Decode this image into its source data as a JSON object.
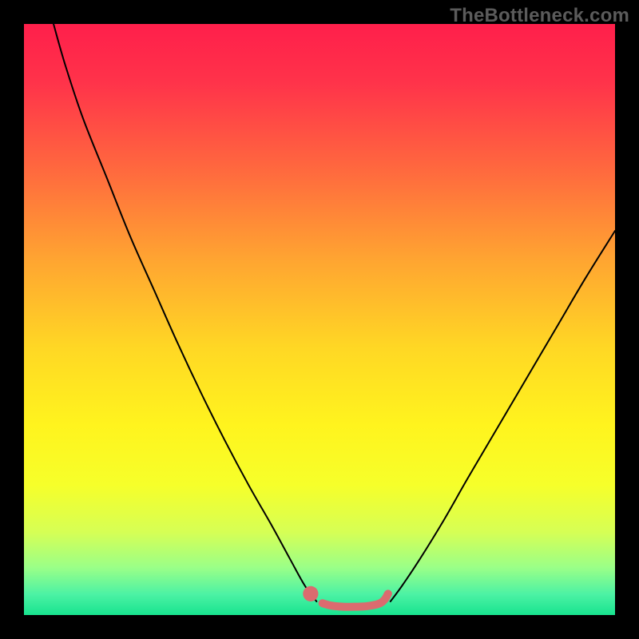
{
  "watermark": "TheBottleneck.com",
  "chart_data": {
    "type": "line",
    "title": "",
    "xlabel": "",
    "ylabel": "",
    "xlim": [
      0,
      100
    ],
    "ylim": [
      0,
      100
    ],
    "grid": false,
    "legend": false,
    "background_gradient_stops": [
      {
        "pos": 0.0,
        "color": "#ff1f4b"
      },
      {
        "pos": 0.1,
        "color": "#ff334a"
      },
      {
        "pos": 0.25,
        "color": "#ff6a3e"
      },
      {
        "pos": 0.4,
        "color": "#ffa531"
      },
      {
        "pos": 0.55,
        "color": "#ffd824"
      },
      {
        "pos": 0.68,
        "color": "#fff41e"
      },
      {
        "pos": 0.78,
        "color": "#f6ff2a"
      },
      {
        "pos": 0.86,
        "color": "#d6ff55"
      },
      {
        "pos": 0.92,
        "color": "#9aff88"
      },
      {
        "pos": 0.965,
        "color": "#4cf2a4"
      },
      {
        "pos": 1.0,
        "color": "#18e38f"
      }
    ],
    "series": [
      {
        "name": "left-curve",
        "color": "#000000",
        "width": 2,
        "points": [
          {
            "x": 5.0,
            "y": 100.0
          },
          {
            "x": 7.0,
            "y": 93.0
          },
          {
            "x": 10.0,
            "y": 84.0
          },
          {
            "x": 14.0,
            "y": 74.0
          },
          {
            "x": 18.0,
            "y": 64.0
          },
          {
            "x": 22.0,
            "y": 55.0
          },
          {
            "x": 26.0,
            "y": 46.0
          },
          {
            "x": 30.0,
            "y": 37.5
          },
          {
            "x": 34.0,
            "y": 29.5
          },
          {
            "x": 38.0,
            "y": 22.0
          },
          {
            "x": 42.0,
            "y": 15.0
          },
          {
            "x": 45.0,
            "y": 9.5
          },
          {
            "x": 47.5,
            "y": 5.0
          },
          {
            "x": 49.5,
            "y": 2.3
          }
        ]
      },
      {
        "name": "right-curve",
        "color": "#000000",
        "width": 2,
        "points": [
          {
            "x": 62.0,
            "y": 2.3
          },
          {
            "x": 64.0,
            "y": 5.0
          },
          {
            "x": 67.0,
            "y": 9.5
          },
          {
            "x": 71.0,
            "y": 16.0
          },
          {
            "x": 75.0,
            "y": 23.0
          },
          {
            "x": 80.0,
            "y": 31.5
          },
          {
            "x": 85.0,
            "y": 40.0
          },
          {
            "x": 90.0,
            "y": 48.5
          },
          {
            "x": 95.0,
            "y": 57.0
          },
          {
            "x": 100.0,
            "y": 65.0
          }
        ]
      },
      {
        "name": "bottom-segment",
        "color": "#db6b6f",
        "width": 10,
        "points": [
          {
            "x": 50.5,
            "y": 2.0
          },
          {
            "x": 52.0,
            "y": 1.6
          },
          {
            "x": 54.0,
            "y": 1.4
          },
          {
            "x": 56.0,
            "y": 1.4
          },
          {
            "x": 58.0,
            "y": 1.5
          },
          {
            "x": 60.0,
            "y": 1.9
          },
          {
            "x": 61.0,
            "y": 2.6
          },
          {
            "x": 61.6,
            "y": 3.6
          }
        ]
      }
    ],
    "markers": [
      {
        "name": "dot-left",
        "x": 48.5,
        "y": 3.6,
        "r": 1.3,
        "color": "#db6b6f"
      }
    ]
  }
}
